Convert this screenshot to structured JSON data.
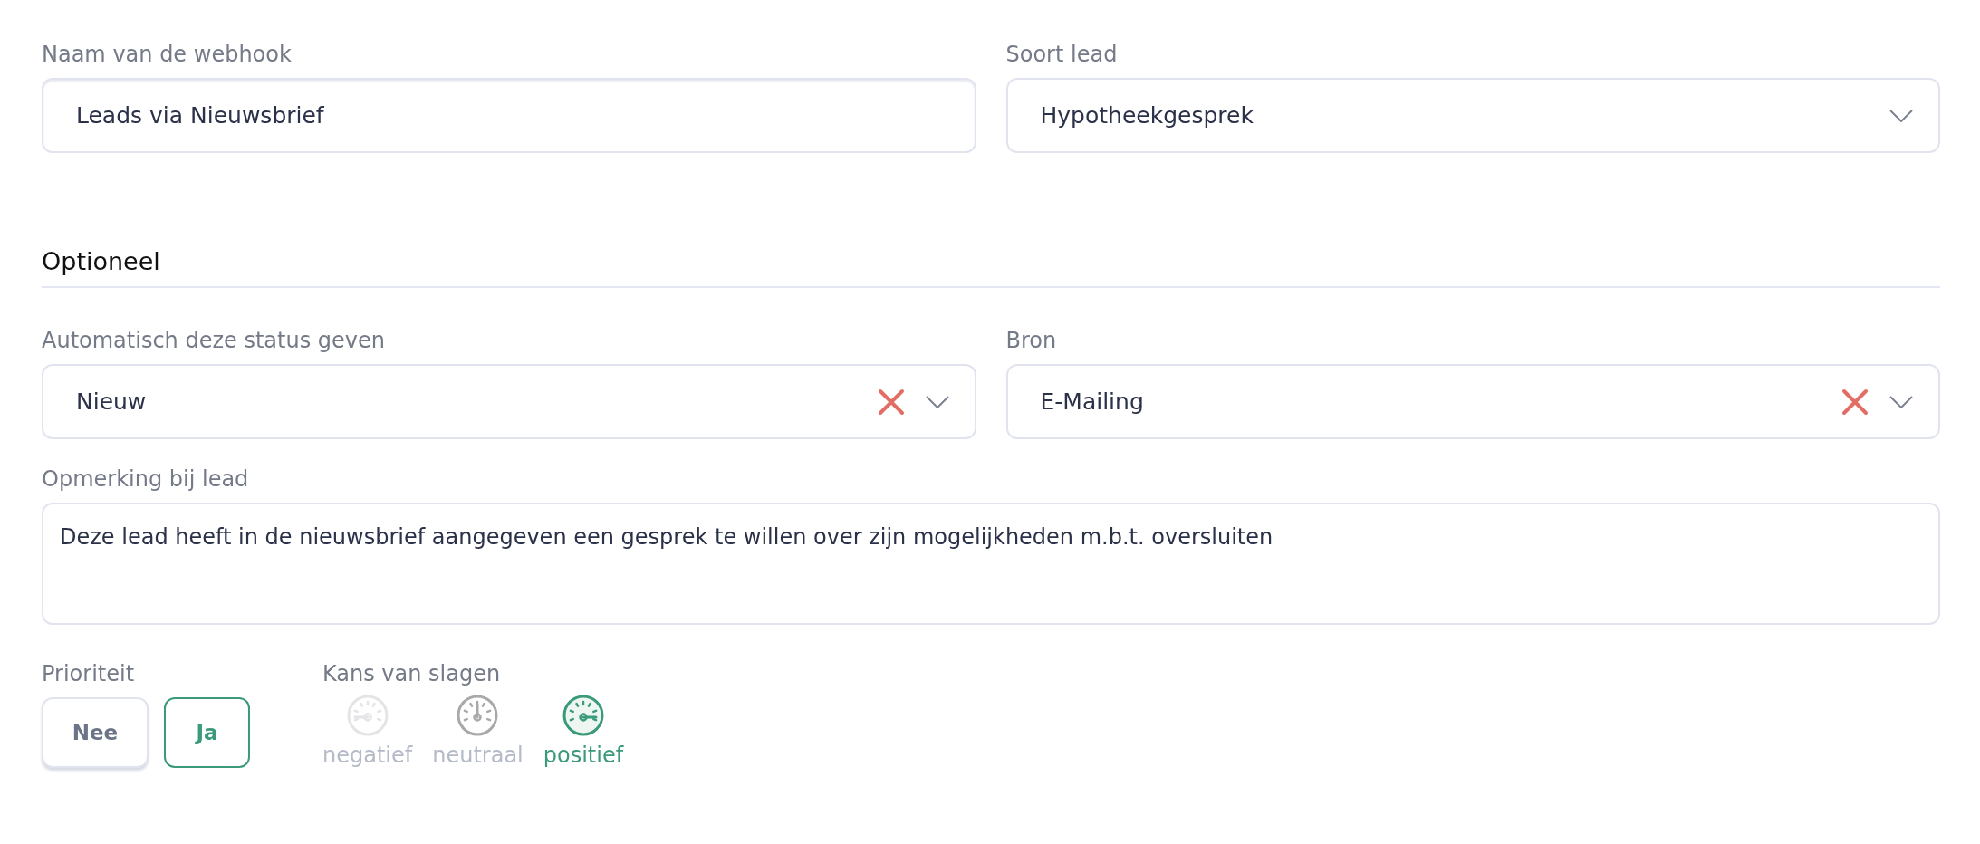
{
  "main_fields": [
    {
      "label": "Naam van de webhook",
      "kind": "text",
      "value": "Leads via Nieuwsbrief"
    },
    {
      "label": "Soort lead",
      "kind": "select",
      "value": "Hypotheekgesprek",
      "clearable": false
    }
  ],
  "section": {
    "title": "Optioneel"
  },
  "optional_fields": [
    {
      "label": "Automatisch deze status geven",
      "kind": "select",
      "value": "Nieuw",
      "clearable": true
    },
    {
      "label": "Bron",
      "kind": "select",
      "value": "E-Mailing",
      "clearable": true
    }
  ],
  "remark": {
    "label": "Opmerking bij lead",
    "value": "Deze lead heeft in de nieuwsbrief aangegeven een gesprek te willen over zijn mogelijkheden m.b.t. oversluiten"
  },
  "priority": {
    "label": "Prioriteit",
    "options": [
      {
        "label": "Nee",
        "selected": false
      },
      {
        "label": "Ja",
        "selected": true
      }
    ]
  },
  "chance": {
    "label": "Kans van slagen",
    "options": [
      {
        "label": "negatief",
        "selected": false,
        "hovered": false,
        "kind": "negative"
      },
      {
        "label": "neutraal",
        "selected": false,
        "hovered": true,
        "kind": "neutral"
      },
      {
        "label": "positief",
        "selected": true,
        "hovered": false,
        "kind": "positive"
      }
    ]
  }
}
